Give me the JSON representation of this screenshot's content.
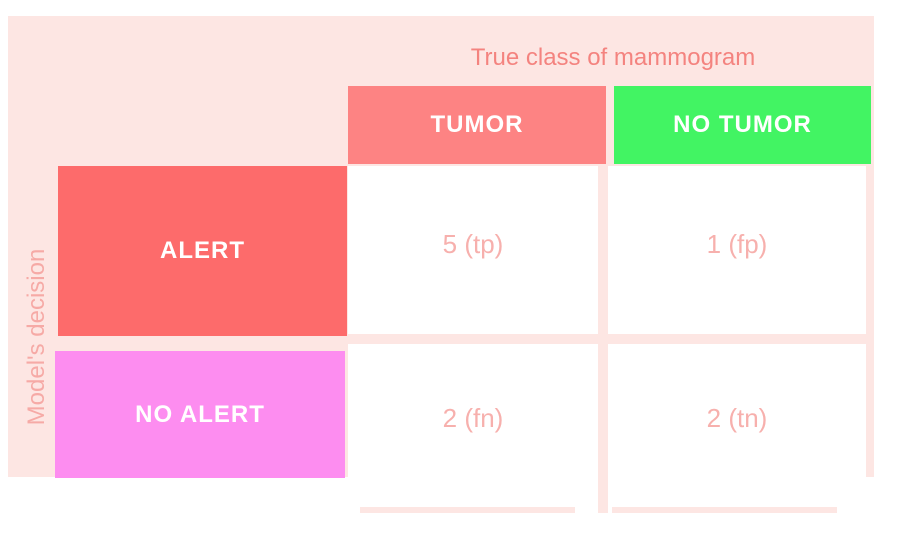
{
  "column_axis_label": "True class of mammogram",
  "row_axis_label": "Model's decision",
  "columns": [
    {
      "label": "TUMOR",
      "color": "#fd8383"
    },
    {
      "label": "NO TUMOR",
      "color": "#42f463"
    }
  ],
  "rows": [
    {
      "label": "ALERT",
      "color": "#fd6b6b"
    },
    {
      "label": "NO ALERT",
      "color": "#fd8df0"
    }
  ],
  "cells": [
    [
      "5 (tp)",
      "1 (fp)"
    ],
    [
      "2 (fn)",
      "2 (tn)"
    ]
  ],
  "chart_data": {
    "type": "table",
    "columns": [
      "TUMOR",
      "NO TUMOR"
    ],
    "rows": [
      "ALERT",
      "NO ALERT"
    ],
    "values": [
      [
        5,
        1
      ],
      [
        2,
        2
      ]
    ],
    "cell_tags": [
      [
        "tp",
        "fp"
      ],
      [
        "fn",
        "tn"
      ]
    ]
  }
}
